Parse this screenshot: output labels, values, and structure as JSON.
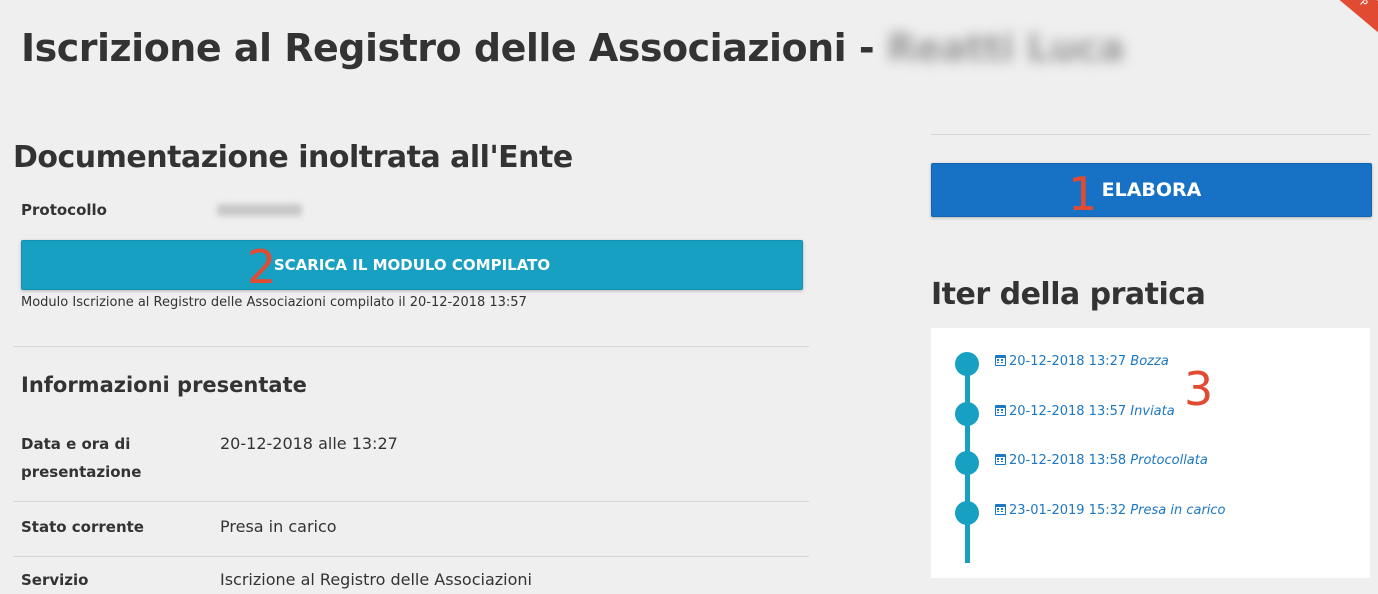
{
  "page": {
    "title_prefix": "Iscrizione al Registro delle Associazioni - ",
    "applicant_name": "Reatti Luca",
    "corner_ribbon": "P"
  },
  "documentation": {
    "title": "Documentazione inoltrata all'Ente",
    "protocol_label": "Protocollo",
    "download_button": "SCARICA IL MODULO COMPILATO",
    "file_caption": "Modulo Iscrizione al Registro delle Associazioni compilato il 20-12-2018 13:57"
  },
  "info": {
    "title": "Informazioni presentate",
    "rows": [
      {
        "label": "Data e ora di presentazione",
        "value": "20-12-2018 alle 13:27"
      },
      {
        "label": "Stato corrente",
        "value": "Presa in carico"
      },
      {
        "label": "Servizio",
        "value": "Iscrizione al Registro delle Associazioni"
      }
    ]
  },
  "actions": {
    "elabora_button": "ELABORA"
  },
  "iter": {
    "title": "Iter della pratica",
    "steps": [
      {
        "date": "20-12-2018 13:27",
        "status": "Bozza"
      },
      {
        "date": "20-12-2018 13:57",
        "status": "Inviata"
      },
      {
        "date": "20-12-2018 13:58",
        "status": "Protocollata"
      },
      {
        "date": "23-01-2019 15:32",
        "status": "Presa in carico"
      }
    ]
  },
  "annotations": [
    "1",
    "2",
    "3"
  ],
  "colors": {
    "accent_teal": "#17a0c2",
    "primary_blue": "#1771c4",
    "link_blue": "#1d77c2",
    "annotation_red": "#e14b32"
  }
}
